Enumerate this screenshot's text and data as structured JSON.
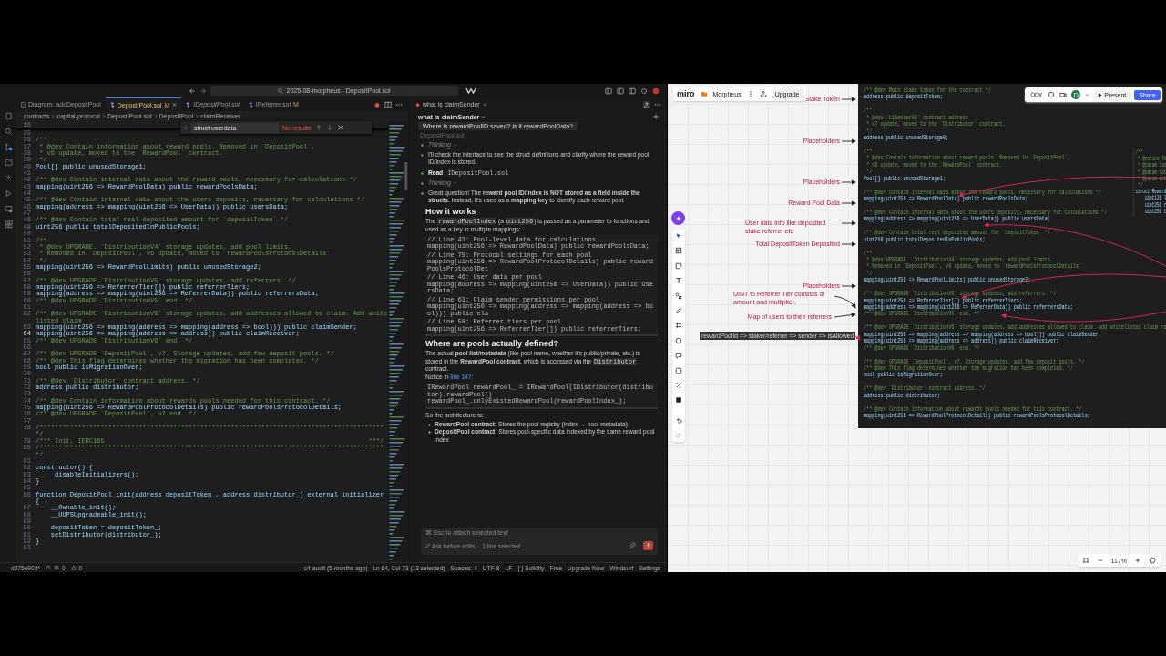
{
  "titlebar": {
    "search": "2025-08-morpheus - DepositPool.sol"
  },
  "editor": {
    "tabs": [
      {
        "label": "Diagram: addDepositPool",
        "kind": "diagram",
        "selected": false,
        "preview": false
      },
      {
        "label": "DepositPool.sol",
        "kind": "sol",
        "badge": "M",
        "selected": true,
        "preview": false
      },
      {
        "label": "IDepositPool.sol",
        "kind": "sol",
        "selected": false,
        "preview": true
      },
      {
        "label": "IReferrer.sol",
        "kind": "sol",
        "badge": "M",
        "selected": false,
        "preview": false
      }
    ],
    "breadcrumbs": [
      "contracts",
      "capital-protocol",
      "DepositPool.sol",
      "DepositPool",
      "claimReceiver"
    ],
    "find": {
      "value": "struct userdata",
      "result": "No results"
    },
    "sticky": "16",
    "lines": [
      {
        "num": "35",
        "current": false
      },
      {
        "num": "36",
        "kind": "comment",
        "text": "/**",
        "current": false
      },
      {
        "num": "37",
        "kind": "comment",
        "text": " * @dev Contain information about reward pools. Removed in `DepositPool`,",
        "current": false
      },
      {
        "num": "38",
        "kind": "comment",
        "text": " * v6 update, moved to the `RewardPool` contract.",
        "current": false
      },
      {
        "num": "39",
        "kind": "comment",
        "text": " */",
        "current": false
      },
      {
        "num": "40",
        "kind": "code",
        "text": "Pool[] public unusedStorage1;",
        "current": false
      },
      {
        "num": "41",
        "current": false
      },
      {
        "num": "42",
        "kind": "comment",
        "text": "/** @dev Contain internal data about the reward pools, necessary for calculations */",
        "current": false
      },
      {
        "num": "43",
        "kind": "code",
        "text": "mapping(uint256 => RewardPoolData) public rewardPoolsData;",
        "current": false
      },
      {
        "num": "44",
        "current": false
      },
      {
        "num": "45",
        "kind": "comment",
        "text": "/** @dev Contain internal data about the users deposits, necessary for calculations */",
        "current": false
      },
      {
        "num": "46",
        "kind": "code",
        "text": "mapping(address => mapping(uint256 => UserData)) public usersData;",
        "current": false
      },
      {
        "num": "47",
        "current": false
      },
      {
        "num": "48",
        "kind": "comment",
        "text": "/** @dev Contain total real deposited amount for `depositToken` */",
        "current": false
      },
      {
        "num": "49",
        "kind": "code",
        "text": "uint256 public totalDepositedInPublicPools;",
        "current": false
      },
      {
        "num": "50",
        "current": false
      },
      {
        "num": "51",
        "kind": "comment",
        "text": "/**",
        "current": false
      },
      {
        "num": "52",
        "kind": "comment",
        "text": " * @dev UPGRADE. `DistributionV4` storage updates, add pool limits.",
        "current": false
      },
      {
        "num": "53",
        "kind": "comment",
        "text": " * Removed in `DepositPool`, v6 update, moved to `rewardPoolsProtocolDetails`",
        "current": false
      },
      {
        "num": "54",
        "kind": "comment",
        "text": " */",
        "current": false
      },
      {
        "num": "55",
        "kind": "code",
        "text": "mapping(uint256 => RewardPoolLimits) public unusedStorage2;",
        "current": false
      },
      {
        "num": "56",
        "current": false
      },
      {
        "num": "57",
        "kind": "comment",
        "text": "/** @dev UPGRADE `DistributionV5` storage updates, add referrers. */",
        "current": false
      },
      {
        "num": "58",
        "kind": "code",
        "text": "mapping(uint256 => ReferrerTier[]) public referrerTiers;",
        "current": false
      },
      {
        "num": "59",
        "kind": "code",
        "text": "mapping(address => mapping(uint256 => ReferrerData)) public referrersData;",
        "current": false
      },
      {
        "num": "60",
        "kind": "comment",
        "text": "/** @dev UPGRADE `DistributionV5` end. */",
        "current": false
      },
      {
        "num": "61",
        "current": false
      },
      {
        "num": "62",
        "kind": "comment",
        "text": "/** @dev UPGRADE `DistributionV6` storage updates, add addresses allowed to claim. Add whitelisted claim",
        "current": false
      },
      {
        "num": "63",
        "kind": "code",
        "text": "mapping(uint256 => mapping(address => mapping(address => bool))) public claimSender;",
        "current": false
      },
      {
        "num": "64",
        "kind": "code",
        "text": "mapping(uint256 => mapping(address => address)) public claimReceiver;",
        "current": true
      },
      {
        "num": "65",
        "kind": "comment",
        "text": "/** @dev UPGRADE `DistributionV6` end. */",
        "current": false
      },
      {
        "num": "66",
        "current": false
      },
      {
        "num": "67",
        "kind": "comment",
        "text": "/** @dev UPGRADE `DepositPool`, v7. Storage updates, add few deposit pools. */",
        "current": false
      },
      {
        "num": "68",
        "kind": "comment",
        "text": "/** @dev This flag determines whether the migration has been completed. */",
        "current": false
      },
      {
        "num": "69",
        "kind": "code",
        "text": "bool public isMigrationOver;",
        "current": false
      },
      {
        "num": "70",
        "current": false
      },
      {
        "num": "71",
        "kind": "comment",
        "text": "/** @dev `Distributor` contract address. */",
        "current": false
      },
      {
        "num": "72",
        "kind": "code",
        "text": "address public distributor;",
        "current": false
      },
      {
        "num": "73",
        "current": false
      },
      {
        "num": "74",
        "kind": "comment",
        "text": "/** @dev Contain information about rewards pools needed for this contract. */",
        "current": false
      },
      {
        "num": "75",
        "kind": "code",
        "text": "mapping(uint256 => RewardPoolProtocolDetails) public rewardPoolsProtocolDetails;",
        "current": false
      },
      {
        "num": "76",
        "kind": "comment",
        "text": "/** @dev UPGRADE `DepositPool`, v7 end. */",
        "current": false
      },
      {
        "num": "77",
        "current": false
      },
      {
        "num": "78",
        "kind": "comment",
        "text": "/*******************************************************************************************/",
        "current": false
      },
      {
        "num": "79",
        "kind": "comment",
        "text": "/*** Init, IERC165                                                                     ***/",
        "current": false
      },
      {
        "num": "80",
        "kind": "comment",
        "text": "/*******************************************************************************************/",
        "current": false
      },
      {
        "num": "81",
        "current": false
      },
      {
        "num": "82",
        "kind": "code",
        "text": "constructor() {",
        "current": false
      },
      {
        "num": "83",
        "kind": "code",
        "text": "    _disableInitializers();",
        "current": false
      },
      {
        "num": "84",
        "kind": "code",
        "text": "}",
        "current": false
      },
      {
        "num": "85",
        "current": false
      },
      {
        "num": "86",
        "kind": "code",
        "text": "function DepositPool_init(address depositToken_, address distributor_) external initializer {",
        "current": false
      },
      {
        "num": "87",
        "kind": "code",
        "text": "    __Ownable_init();",
        "current": false
      },
      {
        "num": "88",
        "kind": "code",
        "text": "    __UUPSUpgradeable_init();",
        "current": false
      },
      {
        "num": "89",
        "current": false
      },
      {
        "num": "90",
        "kind": "code",
        "text": "    depositToken = depositToken_;",
        "current": false
      },
      {
        "num": "91",
        "kind": "code",
        "text": "    setDistributor(distributor_);",
        "current": false
      },
      {
        "num": "92",
        "kind": "code",
        "text": "}",
        "current": false
      },
      {
        "num": "93",
        "current": false
      }
    ]
  },
  "chat": {
    "tab": "what is claimSender",
    "title": "what is claimSender",
    "question": "Where is rewardPoolID saved? is it rewardPoolData?",
    "context": "DepositPool.sol",
    "steps": [
      {
        "kind": "thinking",
        "text": "Thinking"
      },
      {
        "kind": "text",
        "text": "I'll check the interface to see the struct definitions and clarify where the reward pool ID/index is stored."
      },
      {
        "kind": "read",
        "label": "Read",
        "file": "IDepositPool.sol"
      },
      {
        "kind": "thinking",
        "text": "Thinking"
      },
      {
        "kind": "text",
        "text": "Great question! The **reward pool ID/index is NOT stored as a field inside the structs.** Instead, it's used as a **mapping key** to identify each reward pool."
      }
    ],
    "answer": [
      {
        "kind": "heading",
        "text": "How it works"
      },
      {
        "kind": "paragraph",
        "parts": [
          {
            "kind": "text",
            "text": "The "
          },
          {
            "kind": "code",
            "text": "rewardPoolIndex"
          },
          {
            "kind": "text",
            "text": " (a "
          },
          {
            "kind": "code",
            "text": "uint256"
          },
          {
            "kind": "text",
            "text": ") is passed as a parameter to functions and used as a key in multiple mappings:"
          }
        ]
      },
      {
        "kind": "code",
        "groups": [
          [
            "// Line 43: Pool-level data for calculations",
            "mapping(uint256 => RewardPoolData) public rewardPoolsData;"
          ],
          [
            "// Line 75: Protocol settings for each pool",
            "mapping(uint256 => RewardPoolProtocolDetails) public rewardPoolsProtocolDet"
          ],
          [
            "// Line 46: User data per pool",
            "mapping(address => mapping(uint256 => UserData)) public usersData;"
          ],
          [
            "// Line 63: Claim sender permissions per pool",
            "mapping(uint256 => mapping(address => mapping(address => bool))) public cla"
          ],
          [
            "// Line 58: Referrer tiers per pool",
            "mapping(uint256 => ReferrerTier[]) public referrerTiers;"
          ]
        ]
      },
      {
        "kind": "heading",
        "text": "Where are pools actually defined?"
      },
      {
        "kind": "paragraph",
        "parts": [
          {
            "kind": "text",
            "text": "The actual **pool list/metadata** (like pool name, whether it's public/private, etc.) is stored in the **RewardPool contract**, which is accessed via the "
          },
          {
            "kind": "code",
            "text": "Distributor"
          },
          {
            "kind": "text",
            "text": " contract."
          }
        ]
      },
      {
        "kind": "paragraph",
        "parts": [
          {
            "kind": "text",
            "text": "Notice in "
          },
          {
            "kind": "link",
            "text": "line 147"
          },
          {
            "kind": "text",
            "text": ":"
          }
        ]
      },
      {
        "kind": "code",
        "groups": [
          [
            "IRewardPool rewardPool_ = IRewardPool(IDistributor(distributor).rewardPool()",
            "rewardPool_.onlyExistedRewardPool(rewardPoolIndex_);"
          ]
        ]
      },
      {
        "kind": "paragraph",
        "parts": [
          {
            "kind": "text",
            "text": "So the architecture is:"
          }
        ]
      },
      {
        "kind": "bullets",
        "items": [
          "**RewardPool contract:** Stores the pool registry (index → pool metadata)",
          "**DepositPool contract:** Stores pool-specific data indexed by the same reward pool index"
        ]
      }
    ],
    "input": {
      "placeholder": "⌘ Esc to attach selected text",
      "mode": "Ask before edits",
      "selection": "1 line selected"
    }
  },
  "status_bar": {
    "commit": "d275e903*",
    "errors": "0",
    "warnings": "0",
    "right": [
      "c4-audit (5 months ago)",
      "Ln 64, Col 73 (13 selected)",
      "Spaces: 4",
      "UTF-8",
      "LF",
      "{ } Solidity",
      "Free - Upgrade Now",
      "Windsurf - Settings"
    ]
  },
  "miro": {
    "logo": "miro",
    "board": "Morpheus",
    "upgrade": "Upgrade",
    "avatar": "D",
    "present": "Present",
    "share": "Share",
    "zoom": "117%",
    "annotations": [
      {
        "text": "Stake Token"
      },
      {
        "text": "Placeholders"
      },
      {
        "text": "Placeholders"
      },
      {
        "text": "Reward Pool Data"
      },
      {
        "text": "User data info like deposited stake referrer etc"
      },
      {
        "text": "Total DepositToken Deposited"
      },
      {
        "text": "Placeholders"
      },
      {
        "text": "UINT to Referrer Tier consists of amount and multiplier."
      },
      {
        "text": "Map of users to their referrers"
      }
    ],
    "label": "rewardPoolId => staker/referrer => sender => isAllowed",
    "code": [
      {
        "kind": "comment",
        "text": "/** @dev Main stake token for the contract */"
      },
      {
        "kind": "code",
        "text": "address public depositToken;"
      },
      {
        "kind": "blank"
      },
      {
        "kind": "comment",
        "text": "/**"
      },
      {
        "kind": "comment",
        "text": " * @dev `L1SenderV2` contract address"
      },
      {
        "kind": "comment",
        "text": " * v7 update, moved to the `Distributor` contract."
      },
      {
        "kind": "comment",
        "text": " */"
      },
      {
        "kind": "code",
        "text": "address public unusedStorage0;"
      },
      {
        "kind": "blank"
      },
      {
        "kind": "comment",
        "text": "/**"
      },
      {
        "kind": "comment",
        "text": " * @dev Contain information about reward pools. Removed in `DepositPool`,"
      },
      {
        "kind": "comment",
        "text": " * v6 update, moved to the `RewardPool` contract."
      },
      {
        "kind": "comment",
        "text": " */"
      },
      {
        "kind": "code",
        "text": "Pool[] public unusedStorage1;"
      },
      {
        "kind": "blank"
      },
      {
        "kind": "comment",
        "text": "/** @dev Contain internal data about the reward pools, necessary for calculations */"
      },
      {
        "kind": "code",
        "text": "mapping(uint256 => RewardPoolData) public rewardPoolsData;"
      },
      {
        "kind": "blank"
      },
      {
        "kind": "comment",
        "text": "/** @dev Contain internal data about the users deposits, necessary for calculations */"
      },
      {
        "kind": "code",
        "text": "mapping(address => mapping(uint256 => UserData)) public usersData;"
      },
      {
        "kind": "blank"
      },
      {
        "kind": "comment",
        "text": "/** @dev Contain total real deposited amount for `depositToken` */"
      },
      {
        "kind": "code",
        "text": "uint256 public totalDepositedInPublicPools;"
      },
      {
        "kind": "blank"
      },
      {
        "kind": "comment",
        "text": "/**"
      },
      {
        "kind": "comment",
        "text": " * @dev UPGRADE. `DistributionV4` storage updates, add pool limits."
      },
      {
        "kind": "comment",
        "text": " * Removed in `DepositPool`, v6 update, moved to `rewardPoolsProtocolDetails`"
      },
      {
        "kind": "comment",
        "text": " */"
      },
      {
        "kind": "code",
        "text": "mapping(uint256 => RewardPoolLimits) public unusedStorage2;"
      },
      {
        "kind": "blank"
      },
      {
        "kind": "comment",
        "text": "/** @dev UPGRADE `DistributionV5` storage updates, add referrers. */"
      },
      {
        "kind": "code",
        "text": "mapping(uint256 => ReferrerTier[]) public referrerTiers;"
      },
      {
        "kind": "code",
        "text": "mapping(address => mapping(uint256 => ReferrerData)) public referrersData;"
      },
      {
        "kind": "comment",
        "text": "/** @dev UPGRADE `DistributionV5` end. */"
      },
      {
        "kind": "blank"
      },
      {
        "kind": "comment",
        "text": "/** @dev UPGRADE `DistributionV6` storage updates, add addresses allowed to claim. Add whitelisted claim re"
      },
      {
        "kind": "code",
        "text": "mapping(uint256 => mapping(address => mapping(address => bool))) public claimSender;"
      },
      {
        "kind": "code",
        "text": "mapping(uint256 => mapping(address => address)) public claimReceiver;"
      },
      {
        "kind": "comment",
        "text": "/** @dev UPGRADE `DistributionV6` end. */"
      },
      {
        "kind": "blank"
      },
      {
        "kind": "comment",
        "text": "/** @dev UPGRADE `DepositPool`, v7. Storage updates, add few deposit pools. */"
      },
      {
        "kind": "comment",
        "text": "/** @dev This flag determines whether the migration has been completed. */"
      },
      {
        "kind": "code",
        "text": "bool public isMigrationOver;"
      },
      {
        "kind": "blank"
      },
      {
        "kind": "comment",
        "text": "/** @dev `Distributor` contract address. */"
      },
      {
        "kind": "code",
        "text": "address public distributor;"
      },
      {
        "kind": "blank"
      },
      {
        "kind": "comment",
        "text": "/** @dev Contain information about rewards pools needed for this contract. */"
      },
      {
        "kind": "code",
        "text": "mapping(uint256 => RewardPoolProtocolDetails) public rewardPoolsProtocolDetails;"
      }
    ],
    "side_code": [
      {
        "kind": "comment",
        "text": "/**"
      },
      {
        "kind": "comment",
        "text": " * @notice Th"
      },
      {
        "kind": "comment",
        "text": " * @param las"
      },
      {
        "kind": "comment",
        "text": " * @param rat"
      },
      {
        "kind": "comment",
        "text": " * @param tot"
      },
      {
        "kind": "comment",
        "text": " */"
      },
      {
        "kind": "code",
        "text": "struct Reward"
      },
      {
        "kind": "code",
        "text": "    uint128 l"
      },
      {
        "kind": "code",
        "text": "    uint256 r"
      },
      {
        "kind": "code",
        "text": "    uint256 t"
      }
    ]
  }
}
